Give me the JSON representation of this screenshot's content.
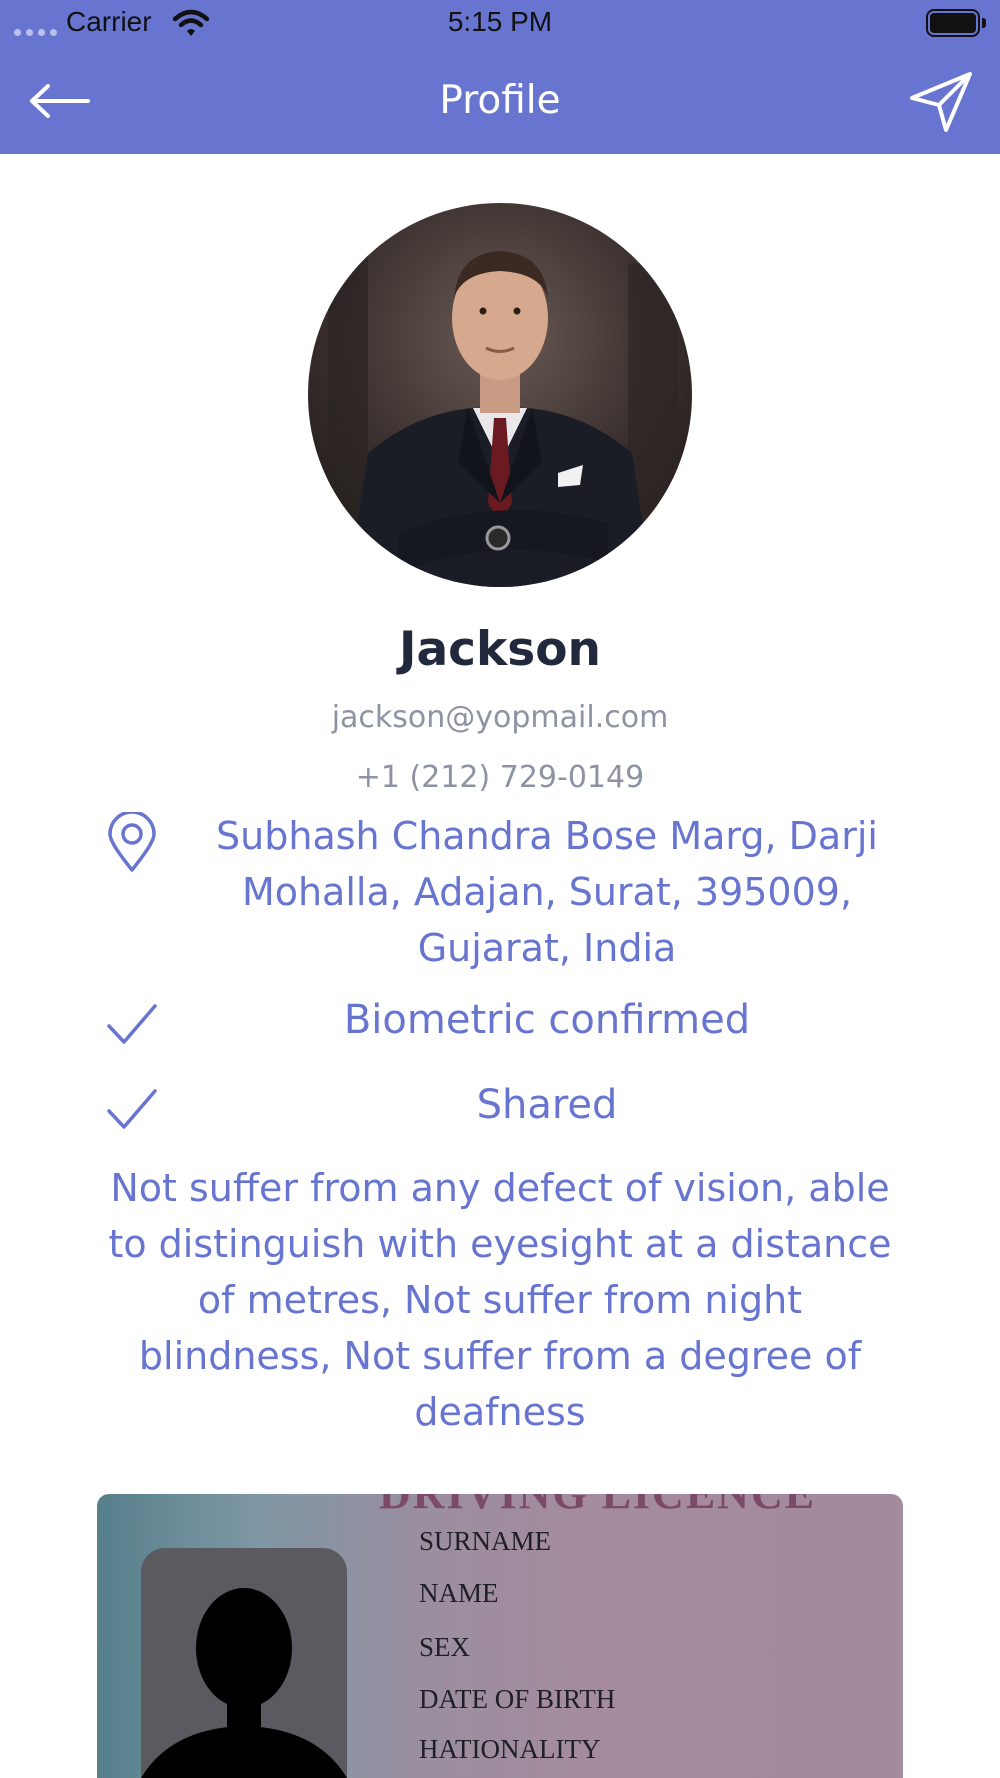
{
  "status_bar": {
    "carrier": "Carrier",
    "time": "5:15 PM"
  },
  "nav": {
    "title": "Profile",
    "back_icon": "arrow-left-icon",
    "send_icon": "send-paper-plane-icon"
  },
  "profile": {
    "name": "Jackson",
    "email": "jackson@yopmail.com",
    "phone": "+1 (212) 729-0149",
    "address_lines": [
      "Subhash Chandra Bose Marg, Darji",
      "Mohalla, Adajan, Surat, 395009,",
      "Gujarat, India"
    ],
    "biometric_status": "Biometric confirmed",
    "shared_status": "Shared",
    "medical_notes_lines": [
      "Not suffer from any defect of vision, able",
      "to distinguish with eyesight at a distance",
      "of metres, Not suffer from night",
      "blindness, Not suffer from a degree of",
      "deafness"
    ]
  },
  "licence": {
    "heading": "DRIVING LICENCE",
    "fields": [
      "SURNAME",
      "NAME",
      "SEX",
      "DATE OF BIRTH",
      "HATIONALITY"
    ]
  },
  "colors": {
    "accent": "#6775d1",
    "name_text": "#23293d",
    "muted_text": "#8d93a3"
  }
}
